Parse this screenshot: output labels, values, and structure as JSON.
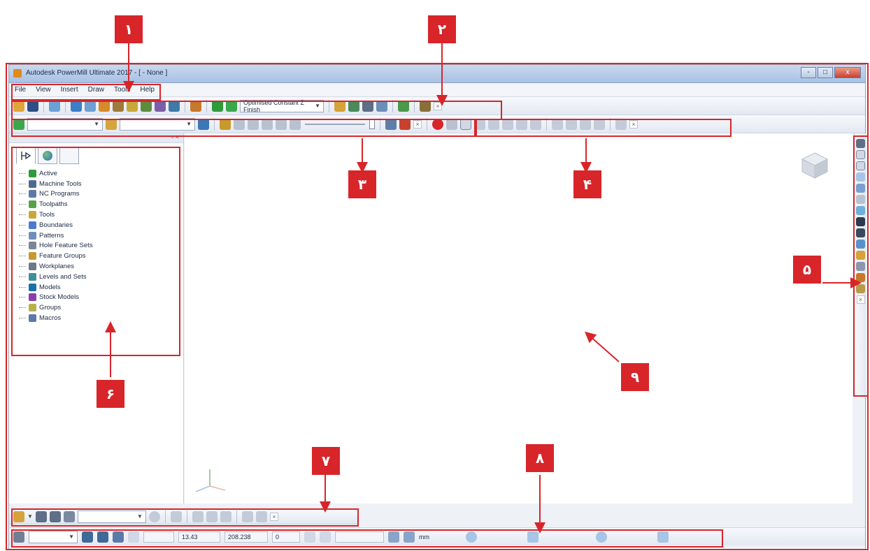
{
  "window": {
    "title": "Autodesk PowerMill Ultimate 2017 - [ - None ]",
    "controls": [
      "-",
      "□",
      "x"
    ]
  },
  "menu": {
    "items": [
      "File",
      "View",
      "Insert",
      "Draw",
      "Tools",
      "Help"
    ]
  },
  "toolbar": {
    "strategy_combo": "Optimised Constant Z Finish"
  },
  "explorer": {
    "items": [
      {
        "label": "Active",
        "color": "#2e9a3a"
      },
      {
        "label": "Machine Tools",
        "color": "#4f6a8c"
      },
      {
        "label": "NC Programs",
        "color": "#5b7aa8"
      },
      {
        "label": "Toolpaths",
        "color": "#57a34a"
      },
      {
        "label": "Tools",
        "color": "#c8a83a"
      },
      {
        "label": "Boundaries",
        "color": "#4a7bd0"
      },
      {
        "label": "Patterns",
        "color": "#6f8fb8"
      },
      {
        "label": "Hole Feature Sets",
        "color": "#7a8596"
      },
      {
        "label": "Feature Groups",
        "color": "#c89a2c"
      },
      {
        "label": "Workplanes",
        "color": "#6d7788"
      },
      {
        "label": "Levels and Sets",
        "color": "#3f8f9a"
      },
      {
        "label": "Models",
        "color": "#1c6fa8"
      },
      {
        "label": "Stock Models",
        "color": "#8a3fa8"
      },
      {
        "label": "Groups",
        "color": "#b8b04a"
      },
      {
        "label": "Macros",
        "color": "#5b7aa8"
      }
    ]
  },
  "statusbar": {
    "value1": "13.43",
    "value2": "208.238",
    "value3": "0",
    "unit": "mm"
  },
  "callouts": [
    "۱",
    "۲",
    "۳",
    "۴",
    "۵",
    "۶",
    "۷",
    "۸",
    "۹"
  ],
  "colors": {
    "callout": "#d7252a"
  }
}
